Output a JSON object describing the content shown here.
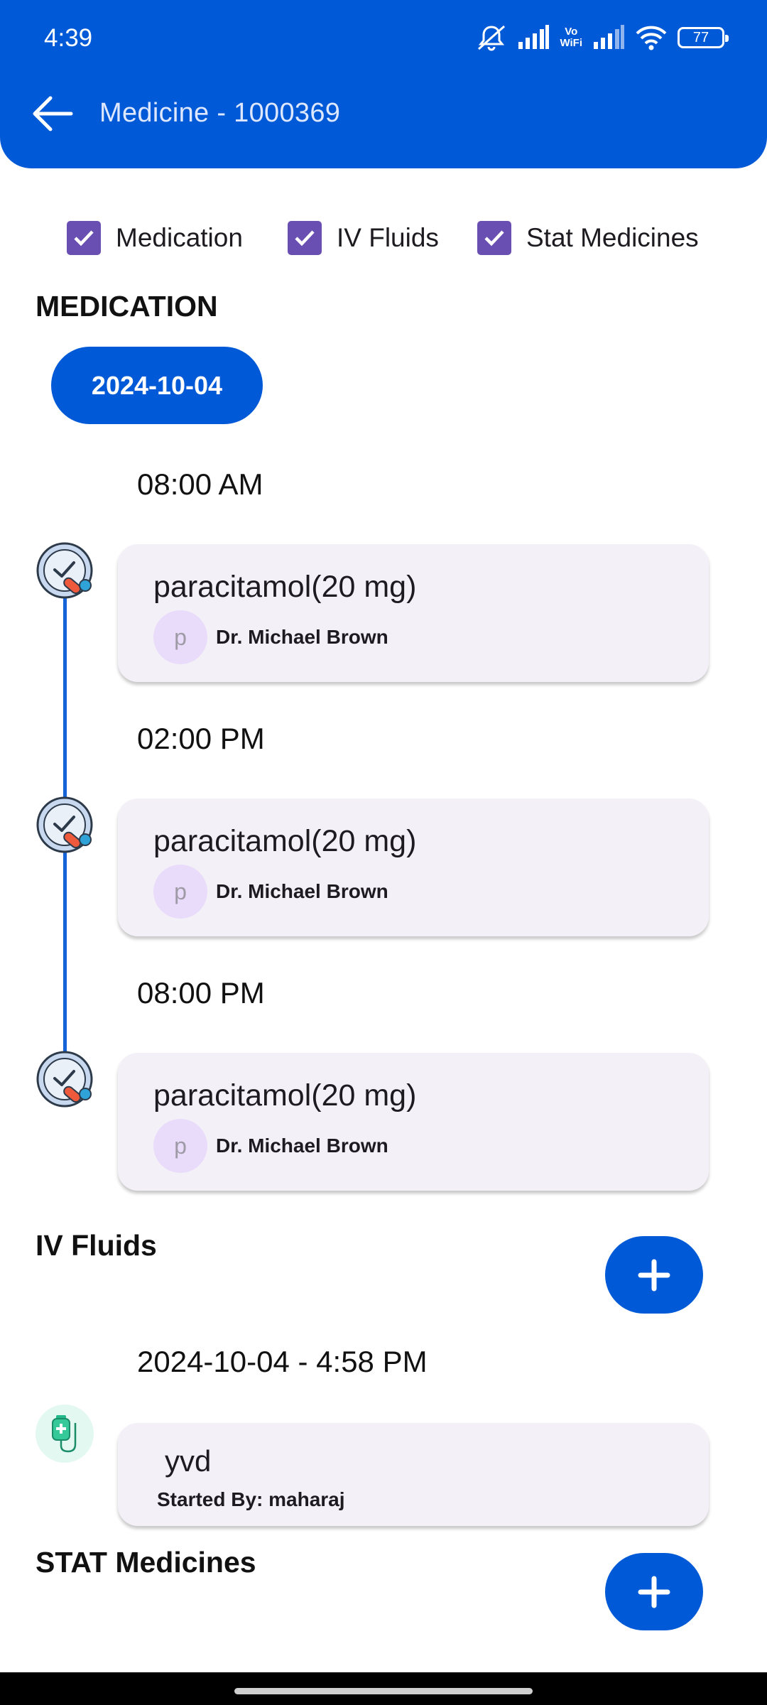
{
  "status_bar": {
    "time": "4:39",
    "vowifi": "Vo\nWiFi",
    "battery": "77"
  },
  "header": {
    "title": "Medicine - 1000369",
    "back_icon": "arrow-left-icon"
  },
  "filters": [
    {
      "label": "Medication",
      "checked": true
    },
    {
      "label": "IV Fluids",
      "checked": true
    },
    {
      "label": "Stat Medicines",
      "checked": true
    }
  ],
  "medication": {
    "section_title": "MEDICATION",
    "date": "2024-10-04",
    "entries": [
      {
        "time": "08:00 AM",
        "name": "paracitamol(20 mg)",
        "avatar_letter": "p",
        "doctor": "Dr. Michael Brown"
      },
      {
        "time": "02:00 PM",
        "name": "paracitamol(20 mg)",
        "avatar_letter": "p",
        "doctor": "Dr. Michael Brown"
      },
      {
        "time": "08:00 PM",
        "name": "paracitamol(20 mg)",
        "avatar_letter": "p",
        "doctor": "Dr. Michael Brown"
      }
    ]
  },
  "iv_fluids": {
    "section_title": "IV Fluids",
    "entries": [
      {
        "datetime": "2024-10-04 - 4:58 PM",
        "name": "yvd",
        "started_by": "Started By: maharaj"
      }
    ]
  },
  "stat_medicines": {
    "section_title": "STAT Medicines"
  },
  "colors": {
    "primary": "#0059d6",
    "checkbox": "#6a4fb3",
    "card_bg": "#f4f0f8",
    "avatar_bg": "#e9dcfb"
  }
}
